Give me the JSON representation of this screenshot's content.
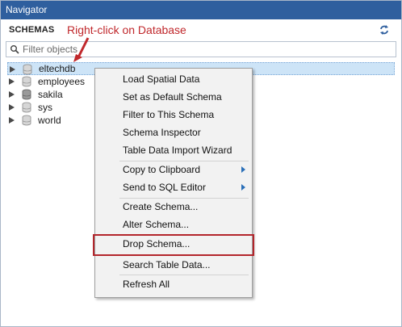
{
  "window": {
    "title": "Navigator"
  },
  "header": {
    "schemas_label": "SCHEMAS",
    "annotation": "Right-click on Database"
  },
  "filter": {
    "placeholder": "Filter objects",
    "value": ""
  },
  "tree": {
    "items": [
      {
        "label": "eltechdb",
        "selected": true
      },
      {
        "label": "employees",
        "selected": false
      },
      {
        "label": "sakila",
        "selected": false
      },
      {
        "label": "sys",
        "selected": false
      },
      {
        "label": "world",
        "selected": false
      }
    ]
  },
  "context_menu": {
    "items": [
      {
        "label": "Load Spatial Data"
      },
      {
        "label": "Set as Default Schema"
      },
      {
        "label": "Filter to This Schema"
      },
      {
        "label": "Schema Inspector"
      },
      {
        "label": "Table Data Import Wizard"
      },
      {
        "label": "Copy to Clipboard",
        "submenu": true
      },
      {
        "label": "Send to SQL Editor",
        "submenu": true
      },
      {
        "label": "Create Schema..."
      },
      {
        "label": "Alter Schema..."
      },
      {
        "label": "Drop Schema...",
        "highlighted": true
      },
      {
        "label": "Search Table Data..."
      },
      {
        "label": "Refresh All"
      }
    ]
  },
  "colors": {
    "titlebar": "#2f5f9e",
    "annotation": "#c0282c",
    "highlight_border": "#b3262c",
    "selection": "#cde4f7"
  }
}
